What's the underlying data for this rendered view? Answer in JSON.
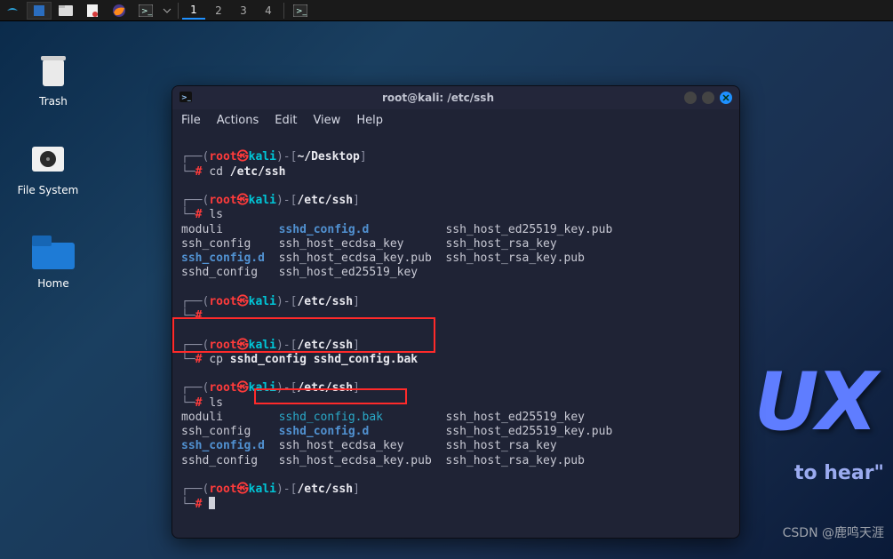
{
  "taskbar": {
    "workspaces": [
      "1",
      "2",
      "3",
      "4"
    ],
    "active_workspace": "1"
  },
  "desktop": {
    "icons": [
      {
        "label": "Trash"
      },
      {
        "label": "File System"
      },
      {
        "label": "Home"
      }
    ]
  },
  "terminal": {
    "title": "root@kali: /etc/ssh",
    "menu": [
      "File",
      "Actions",
      "Edit",
      "View",
      "Help"
    ],
    "location": "/etc/ssh",
    "home_location": "~/Desktop",
    "user": "root",
    "host": "kali",
    "cmds": {
      "cd": "cd",
      "cd_arg": "/etc/ssh",
      "ls": "ls",
      "cp": "cp",
      "cp_args": "sshd_config sshd_config.bak"
    },
    "ls1_col1": [
      "moduli",
      "ssh_config",
      "ssh_config.d",
      "sshd_config"
    ],
    "ls1_col2": [
      "sshd_config.d",
      "ssh_host_ecdsa_key",
      "ssh_host_ecdsa_key.pub",
      "ssh_host_ed25519_key"
    ],
    "ls1_col3": [
      "ssh_host_ed25519_key.pub",
      "ssh_host_rsa_key",
      "ssh_host_rsa_key.pub"
    ],
    "ls2_col1": [
      "moduli",
      "ssh_config",
      "ssh_config.d",
      "sshd_config"
    ],
    "ls2_col2": [
      "sshd_config.bak",
      "sshd_config.d",
      "ssh_host_ecdsa_key",
      "ssh_host_ecdsa_key.pub"
    ],
    "ls2_col3": [
      "ssh_host_ed25519_key",
      "ssh_host_ed25519_key.pub",
      "ssh_host_rsa_key",
      "ssh_host_rsa_key.pub"
    ]
  },
  "watermark": "CSDN @鹿鸣天涯",
  "bg_slogan": "to hear\"",
  "bg_brand": "UX"
}
